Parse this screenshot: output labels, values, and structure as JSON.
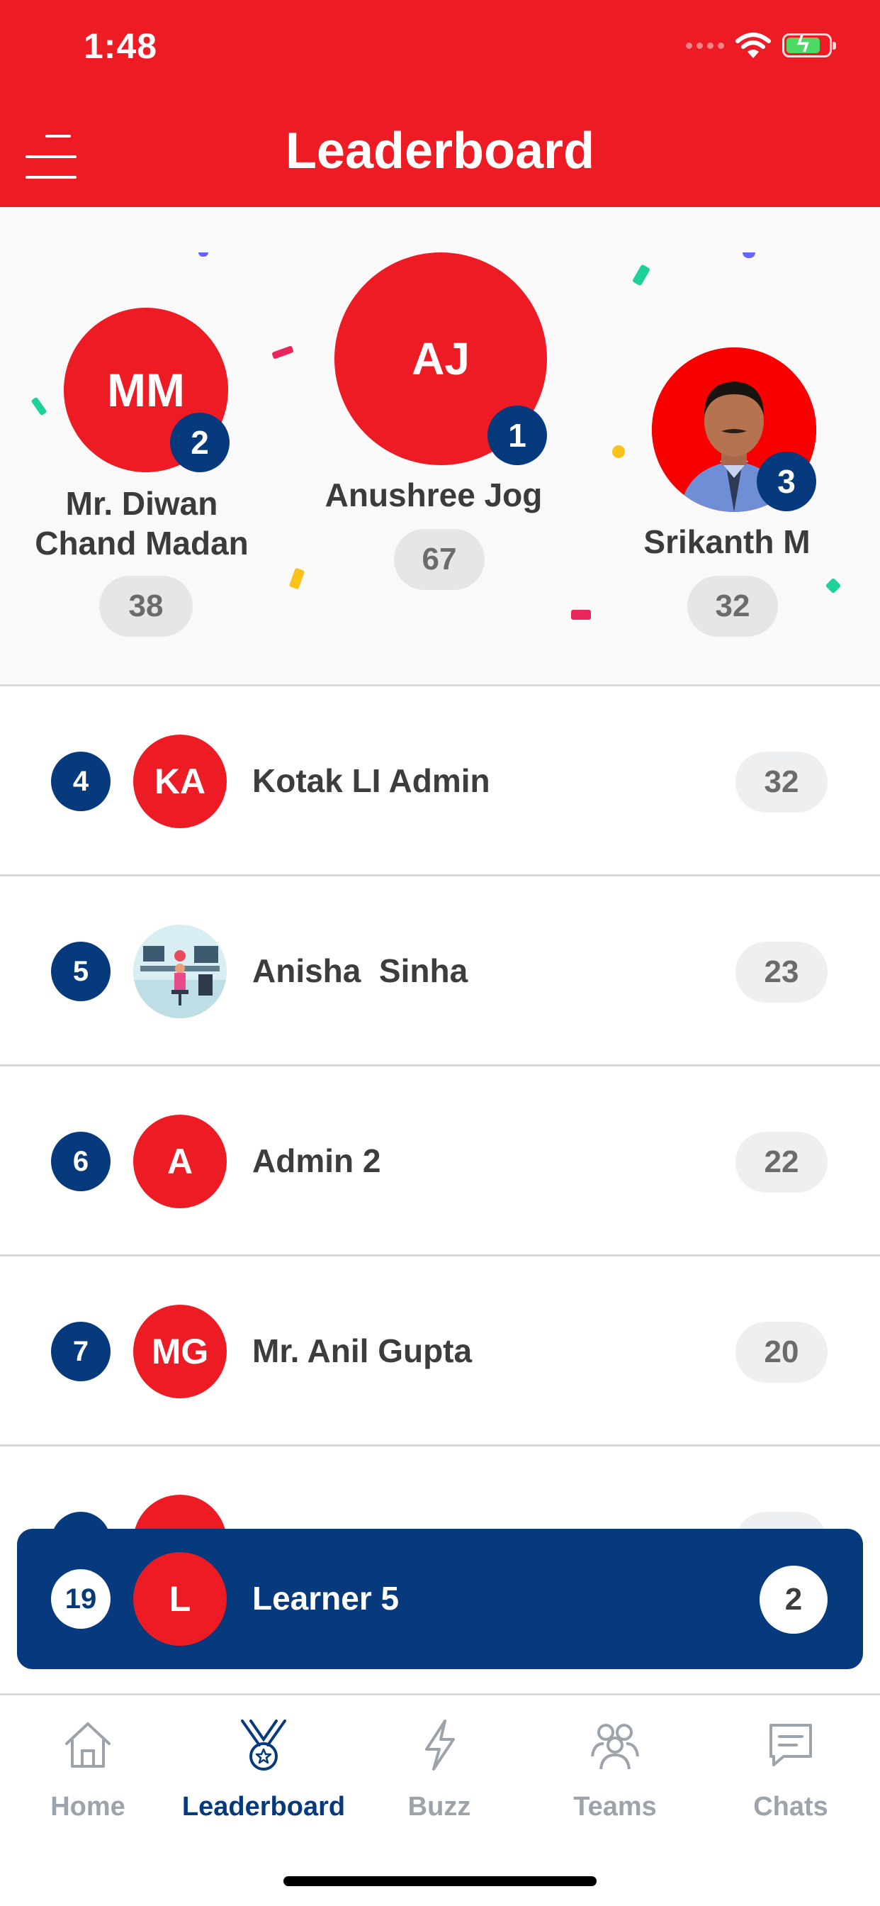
{
  "status_bar": {
    "time": "1:48"
  },
  "header": {
    "title": "Leaderboard"
  },
  "podium": {
    "first": {
      "initials": "AJ",
      "rank": "1",
      "name": "Anushree Jog",
      "score": "67"
    },
    "second": {
      "initials": "MM",
      "rank": "2",
      "name_line1": "Mr. Diwan",
      "name_line2": "Chand Madan",
      "score": "38"
    },
    "third": {
      "rank": "3",
      "name": "Srikanth M",
      "score": "32"
    }
  },
  "rows": [
    {
      "rank": "4",
      "initials": "KA",
      "name": "Kotak LI Admin",
      "score": "32"
    },
    {
      "rank": "5",
      "initials": "",
      "name": "Anisha  Sinha",
      "score": "23"
    },
    {
      "rank": "6",
      "initials": "A",
      "name": "Admin 2",
      "score": "22"
    },
    {
      "rank": "7",
      "initials": "MG",
      "name": "Mr. Anil Gupta",
      "score": "20"
    }
  ],
  "current_user": {
    "rank": "19",
    "initials": "L",
    "name": "Learner 5",
    "score": "2"
  },
  "tabs": [
    {
      "label": "Home",
      "icon": "home-icon",
      "active": false
    },
    {
      "label": "Leaderboard",
      "icon": "medal-icon",
      "active": true
    },
    {
      "label": "Buzz",
      "icon": "bolt-icon",
      "active": false
    },
    {
      "label": "Teams",
      "icon": "people-icon",
      "active": false
    },
    {
      "label": "Chats",
      "icon": "chat-icon",
      "active": false
    }
  ],
  "colors": {
    "brand_red": "#ED1C24",
    "navy": "#063A7C",
    "inactive": "#9DA3AA"
  }
}
